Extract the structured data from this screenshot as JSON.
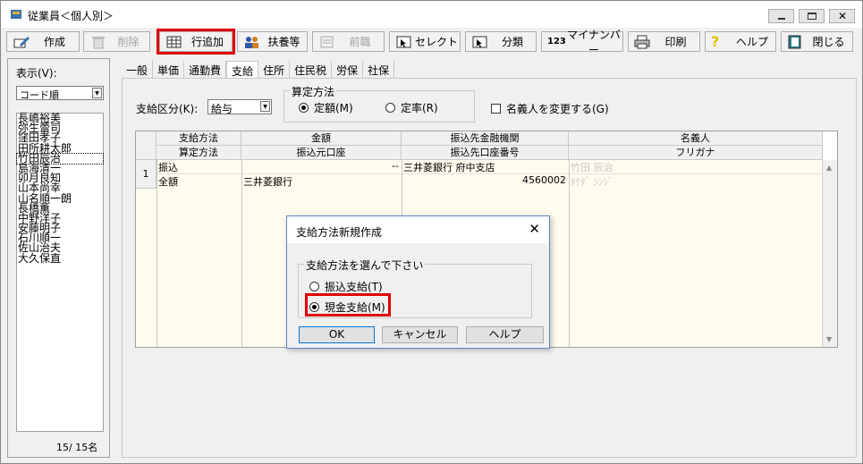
{
  "window": {
    "title": "従業員＜個人別＞"
  },
  "toolbar": {
    "buttons": [
      {
        "label": "作成",
        "icon": "create-icon"
      },
      {
        "label": "削除",
        "icon": "trash-icon"
      },
      {
        "label": "行追加",
        "icon": "add-row-icon"
      },
      {
        "label": "扶養等",
        "icon": "dependents-icon"
      },
      {
        "label": "前職",
        "icon": "previous-job-icon"
      },
      {
        "label": "セレクト",
        "icon": "select-icon"
      },
      {
        "label": "分類",
        "icon": "classify-icon"
      },
      {
        "label": "マイナンバー",
        "icon": "my-number-icon"
      },
      {
        "label": "印刷",
        "icon": "printer-icon"
      },
      {
        "label": "ヘルプ",
        "icon": "help-icon"
      },
      {
        "label": "閉じる",
        "icon": "close-book-icon"
      }
    ]
  },
  "left": {
    "display_label": "表示(V):",
    "sort_value": "コード順",
    "employees": [
      "長嶋裕美",
      "弥生蕾司",
      "窪田孝子",
      "田所耕太郎",
      "竹田辰治",
      "島海清一",
      "卯月良知",
      "山本尚幸",
      "山名順一朗",
      "長橋薫",
      "中野洋子",
      "安藤明子",
      "石川順一",
      "佐山治夫",
      "大久保直"
    ],
    "counter": "15/  15名"
  },
  "tabs": [
    "一般",
    "単価",
    "通勤費",
    "支給",
    "住所",
    "住民税",
    "労保",
    "社保"
  ],
  "form": {
    "kubun_label": "支給区分(K):",
    "kubun_value": "給与",
    "santei_title": "算定方法",
    "santei_options": [
      "定額(M)",
      "定率(R)"
    ],
    "meigi_check_label": "名義人を変更する(G)"
  },
  "grid": {
    "headers_top": [
      "支給方法",
      "金額",
      "振込先金融機関",
      "名義人"
    ],
    "headers_bottom": [
      "算定方法",
      "振込元口座",
      "振込先口座番号",
      "フリガナ"
    ],
    "row_no": "1",
    "row1": [
      "振込",
      "--",
      "三井菱銀行 府中支店",
      "竹田 辰治"
    ],
    "row2": [
      "全額",
      "三井菱銀行",
      "4560002",
      "ﾀｹﾀﾞ ｼﾝｼﾞ"
    ]
  },
  "dialog": {
    "title": "支給方法新規作成",
    "group_title": "支給方法を選んで下さい",
    "options": [
      "振込支給(T)",
      "現金支給(M)"
    ],
    "ok": "OK",
    "cancel": "キャンセル",
    "help": "ヘルプ"
  }
}
